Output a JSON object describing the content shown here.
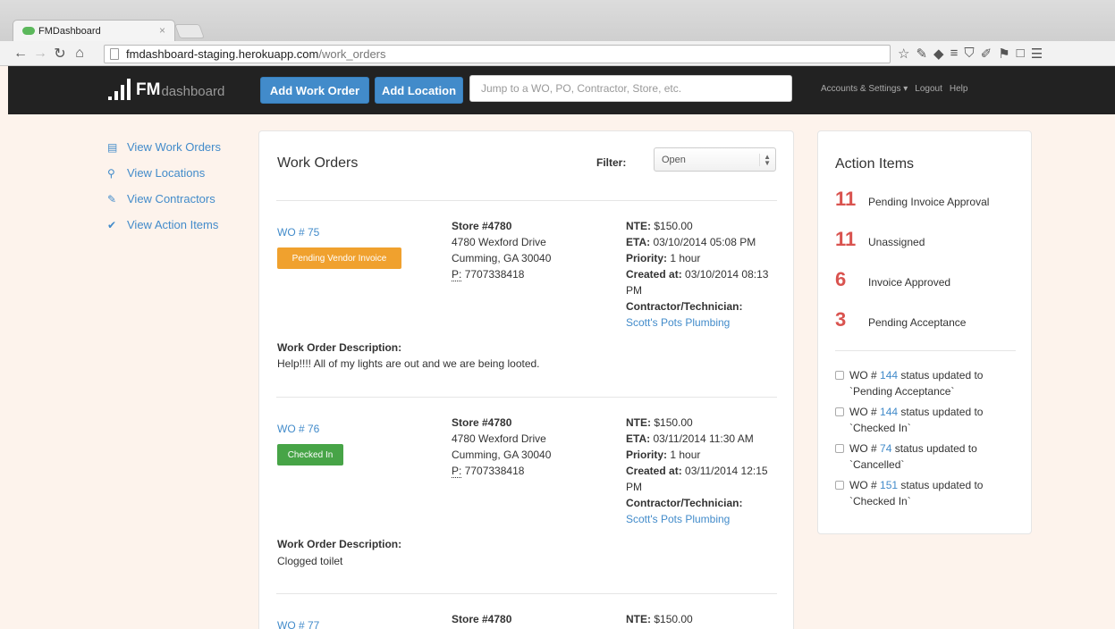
{
  "browser": {
    "tab_title": "FMDashboard",
    "tab_close": "×",
    "url_host": "fmdashboard-staging.herokuapp.com",
    "url_path": "/work_orders"
  },
  "navbar": {
    "brand_strong": "FM",
    "brand_light": "dashboard",
    "add_work_order": "Add Work Order",
    "add_location": "Add Location",
    "search_placeholder": "Jump to a WO, PO, Contractor, Store, etc.",
    "accounts": "Accounts & Settings ▾",
    "logout": "Logout",
    "help": "Help"
  },
  "sidebar": {
    "items": [
      {
        "label": "View Work Orders",
        "icon": "list-icon"
      },
      {
        "label": "View Locations",
        "icon": "map-marker-icon"
      },
      {
        "label": "View Contractors",
        "icon": "wrench-icon"
      },
      {
        "label": "View Action Items",
        "icon": "check-icon"
      }
    ]
  },
  "work_orders": {
    "title": "Work Orders",
    "filter_label": "Filter:",
    "filter_value": "Open",
    "desc_label": "Work Order Description:",
    "items": [
      {
        "wo": "WO # 75",
        "badge": "Pending Vendor Invoice",
        "store": "Store #4780",
        "address1": "4780 Wexford Drive",
        "address2": "Cumming, GA 30040",
        "phone_label": "P:",
        "phone": "7707338418",
        "nte_label": "NTE:",
        "nte": "$150.00",
        "eta_label": "ETA:",
        "eta": "03/10/2014 05:08 PM",
        "priority_label": "Priority:",
        "priority": "1 hour",
        "created_label": "Created at:",
        "created": "03/10/2014 08:13 PM",
        "contractor_label": "Contractor/Technician:",
        "contractor": "Scott's Pots Plumbing",
        "description": "Help!!!! All of my lights are out and we are being looted."
      },
      {
        "wo": "WO # 76",
        "badge": "Checked In",
        "store": "Store #4780",
        "address1": "4780 Wexford Drive",
        "address2": "Cumming, GA 30040",
        "phone_label": "P:",
        "phone": "7707338418",
        "nte_label": "NTE:",
        "nte": "$150.00",
        "eta_label": "ETA:",
        "eta": "03/11/2014 11:30 AM",
        "priority_label": "Priority:",
        "priority": "1 hour",
        "created_label": "Created at:",
        "created": "03/11/2014 12:15 PM",
        "contractor_label": "Contractor/Technician:",
        "contractor": "Scott's Pots Plumbing",
        "description": "Clogged toilet"
      },
      {
        "wo": "WO # 77",
        "store": "Store #4780",
        "nte_label": "NTE:",
        "nte": "$150.00"
      }
    ]
  },
  "action_items": {
    "title": "Action Items",
    "counts": [
      {
        "count": "11",
        "label": "Pending Invoice Approval"
      },
      {
        "count": "11",
        "label": "Unassigned"
      },
      {
        "count": "6",
        "label": "Invoice Approved"
      },
      {
        "count": "3",
        "label": "Pending Acceptance"
      }
    ],
    "updates": [
      {
        "prefix": "WO #",
        "number": "144",
        "text": "status updated to",
        "status": "`Pending Acceptance`"
      },
      {
        "prefix": "WO #",
        "number": "144",
        "text": "status updated to",
        "status": "`Checked In`"
      },
      {
        "prefix": "WO #",
        "number": "74",
        "text": "status updated to",
        "status": "`Cancelled`"
      },
      {
        "prefix": "WO #",
        "number": "151",
        "text": "status updated to",
        "status": "`Checked In`"
      }
    ]
  },
  "colors": {
    "accent": "#428bca",
    "pending_badge": "#f0a12e",
    "checked_in_badge": "#47a447",
    "count_red": "#d9534f",
    "navbar": "#222222",
    "page_bg": "#fdf3ec"
  }
}
